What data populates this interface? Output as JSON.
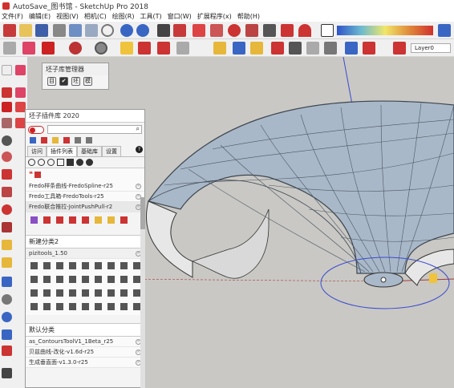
{
  "window": {
    "title": "AutoSave_图书馆 - SketchUp Pro 2018"
  },
  "menu": [
    "文件(F)",
    "编辑(E)",
    "视图(V)",
    "相机(C)",
    "绘图(R)",
    "工具(T)",
    "窗口(W)",
    "扩展程序(x)",
    "帮助(H)"
  ],
  "toolbar": {
    "layer_label": "Layer0"
  },
  "plugin_manager": {
    "title": "坯子库管理器",
    "buttons": [
      "目",
      "✔",
      "坯",
      "模"
    ]
  },
  "plugin_library": {
    "title": "坯子插件库 2020",
    "tabs": [
      "访问",
      "插件列表",
      "基础库",
      "设置"
    ],
    "list": [
      "Fredo样条曲线-FredoSpline-r25",
      "Fredo工具箱-FredoTools-r25",
      "Fredo联合推拉-JointPushPull-r2"
    ],
    "new_category": {
      "label": "新建分类2"
    },
    "pizitools": {
      "label": "pizitools_1.50"
    },
    "default_category": {
      "label": "默认分类"
    },
    "default_list": [
      "as_ContoursToolV1_1Beta_r25",
      "贝兹曲线-改化-v1.6d-r25",
      "生成垂直面-v1.3.0-r25"
    ]
  },
  "colors": {
    "canvas_bg": "#c9c8c4",
    "model_surface": "#a9b8c8",
    "axis_blue": "#3a4bd0",
    "accent_red": "#d0312d"
  },
  "icons": [
    "sketchup-app-icon",
    "select-arrow-icon",
    "eraser-icon",
    "pencil-icon",
    "rectangle-icon",
    "circle-icon",
    "push-pull-icon",
    "move-icon",
    "rotate-icon",
    "scale-icon",
    "tape-measure-icon",
    "paint-bucket-icon",
    "orbit-icon",
    "pan-icon",
    "zoom-icon",
    "zoom-extents-icon",
    "section-plane-icon",
    "search-icon",
    "help-icon",
    "close-icon",
    "footprints-icon"
  ]
}
